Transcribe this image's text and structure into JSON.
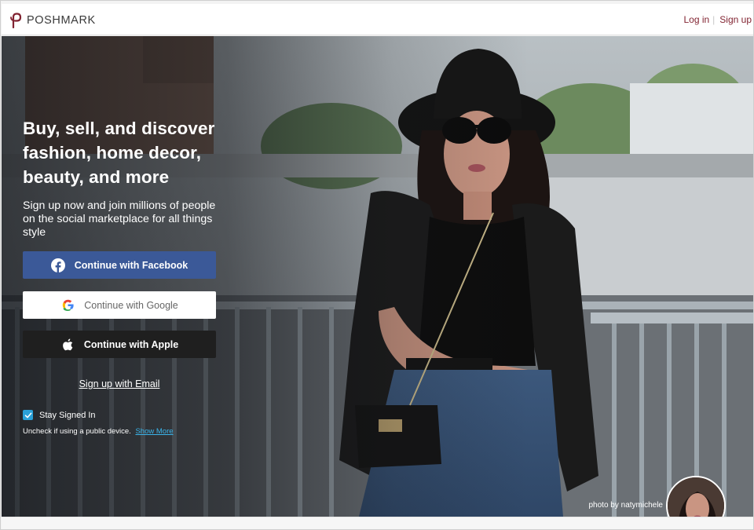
{
  "header": {
    "brand": "POSHMARK",
    "login_label": "Log in",
    "signup_label": "Sign up"
  },
  "hero": {
    "headline": "Buy, sell, and discover fashion, home decor, beauty, and more",
    "subtext": "Sign up now and join millions of people on the social marketplace for all things style",
    "facebook_label": "Continue with Facebook",
    "google_label": "Continue with Google",
    "apple_label": "Continue with Apple",
    "email_label": "Sign up with Email",
    "stay_signed_in_label": "Stay Signed In",
    "stay_signed_in_checked": true,
    "uncheck_note": "Uncheck if using a public device.",
    "show_more_label": "Show More",
    "photo_credit": "photo by natymichele"
  },
  "colors": {
    "brand": "#822432",
    "facebook": "#3b5998",
    "apple": "#1f1f1f",
    "link_blue": "#3ab4ea",
    "checkbox": "#2aa0d7"
  }
}
